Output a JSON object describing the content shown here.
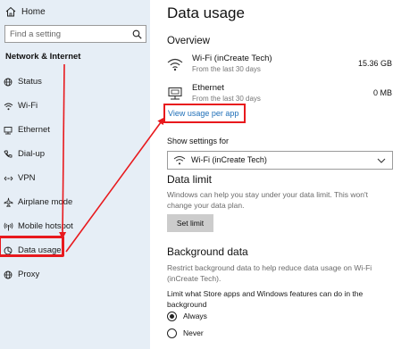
{
  "sidebar": {
    "home_label": "Home",
    "search_placeholder": "Find a setting",
    "group_title": "Network & Internet",
    "items": [
      {
        "label": "Status",
        "icon": "globe-icon"
      },
      {
        "label": "Wi-Fi",
        "icon": "wifi-icon"
      },
      {
        "label": "Ethernet",
        "icon": "ethernet-icon"
      },
      {
        "label": "Dial-up",
        "icon": "phone-icon"
      },
      {
        "label": "VPN",
        "icon": "vpn-icon"
      },
      {
        "label": "Airplane mode",
        "icon": "airplane-icon"
      },
      {
        "label": "Mobile hotspot",
        "icon": "hotspot-icon"
      },
      {
        "label": "Data usage",
        "icon": "data-usage-icon",
        "active": true
      },
      {
        "label": "Proxy",
        "icon": "globe-icon"
      }
    ]
  },
  "main": {
    "title": "Data usage",
    "overview": {
      "heading": "Overview",
      "rows": [
        {
          "name": "Wi-Fi (inCreate Tech)",
          "sub": "From the last 30 days",
          "value": "15.36 GB",
          "icon": "wifi-icon"
        },
        {
          "name": "Ethernet",
          "sub": "From the last 30 days",
          "value": "0 MB",
          "icon": "ethernet-icon"
        }
      ],
      "link": "View usage per app"
    },
    "show_settings": {
      "label": "Show settings for",
      "selected": "Wi-Fi (inCreate Tech)"
    },
    "data_limit": {
      "heading": "Data limit",
      "description": "Windows can help you stay under your data limit. This won't change your data plan.",
      "button": "Set limit"
    },
    "background_data": {
      "heading": "Background data",
      "description": "Restrict background data to help reduce data usage on Wi-Fi (inCreate Tech).",
      "limit_label": "Limit what Store apps and Windows features can do in the background",
      "options": [
        {
          "label": "Always",
          "selected": true
        },
        {
          "label": "Never",
          "selected": false
        }
      ]
    }
  },
  "colors": {
    "sidebar_bg": "#e6eef6",
    "accent_link": "#1f6fb8",
    "annotation_red": "#e8191d"
  }
}
